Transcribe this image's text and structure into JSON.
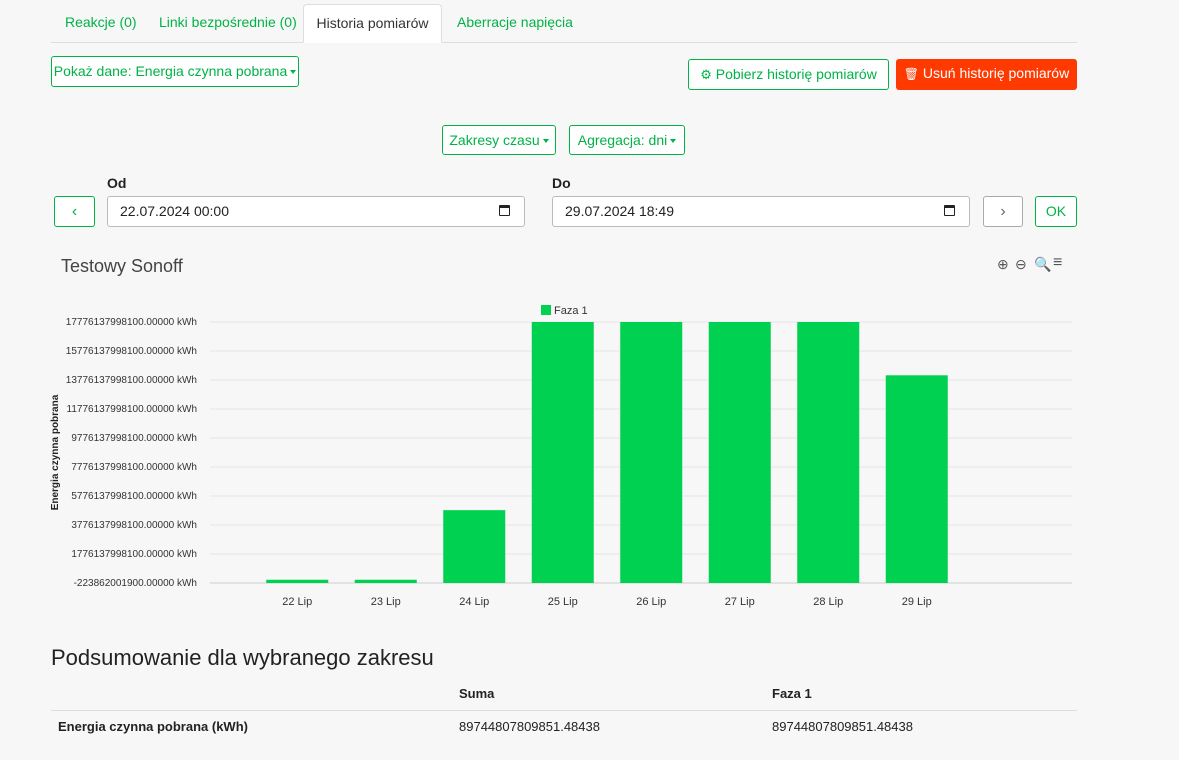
{
  "tabs": [
    {
      "label": "Reakcje (0)",
      "active": false
    },
    {
      "label": "Linki bezpośrednie (0)",
      "active": false
    },
    {
      "label": "Historia pomiarów",
      "active": true
    },
    {
      "label": "Aberracje napięcia",
      "active": false
    }
  ],
  "toolbar": {
    "show_data_label": "Pokaż dane: Energia czynna pobrana",
    "download_label": "Pobierz historię pomiarów",
    "delete_label": "Usuń historię pomiarów"
  },
  "range": {
    "time_ranges_label": "Zakresy czasu",
    "aggregation_label": "Agregacja: dni",
    "from_label": "Od",
    "from_value": "22.07.2024 00:00",
    "to_label": "Do",
    "to_value": "29.07.2024 18:49",
    "ok_label": "OK"
  },
  "colors": {
    "accent": "#00b346",
    "bar": "#00d150",
    "danger": "#ff3a00"
  },
  "chart_data": {
    "type": "bar",
    "title": "Testowy Sonoff",
    "ylabel": "Energia czynna pobrana",
    "categories": [
      "22 Lip",
      "23 Lip",
      "24 Lip",
      "25 Lip",
      "26 Lip",
      "27 Lip",
      "28 Lip",
      "29 Lip"
    ],
    "series": [
      {
        "name": "Faza 1",
        "values": [
          0,
          0,
          4800000000000,
          17776137998100,
          17776137998100,
          17776137998100,
          17776137998100,
          14100000000000
        ]
      }
    ],
    "yticks": [
      "17776137998100.00000 kWh",
      "15776137998100.00000 kWh",
      "13776137998100.00000 kWh",
      "11776137998100.00000 kWh",
      "9776137998100.00000 kWh",
      "7776137998100.00000 kWh",
      "5776137998100.00000 kWh",
      "3776137998100.00000 kWh",
      "1776137998100.00000 kWh",
      "-223862001900.00000 kWh"
    ],
    "ylim": [
      -223862001900,
      17776137998100
    ],
    "grid": true,
    "legend": "top"
  },
  "summary": {
    "title": "Podsumowanie dla wybranego zakresu",
    "headers": [
      "",
      "Suma",
      "Faza 1"
    ],
    "rows": [
      [
        "Energia czynna pobrana (kWh)",
        "89744807809851.48438",
        "89744807809851.48438"
      ]
    ]
  }
}
